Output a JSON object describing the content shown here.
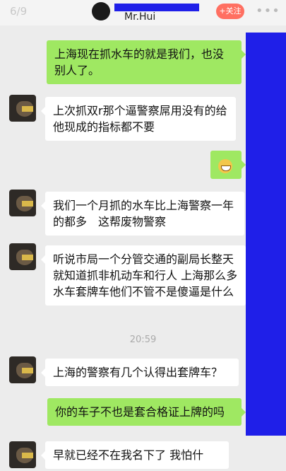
{
  "header": {
    "counter": "6/9",
    "username": "Mr.Hui",
    "follow_label": "+关注",
    "more_icon": "more-dots-icon"
  },
  "timestamp": "20:59",
  "messages": [
    {
      "side": "right",
      "text": "上海现在抓水车的就是我们，也没别人了。"
    },
    {
      "side": "left",
      "text": "上次抓双r那个逼警察屌用没有的给他现成的指标都不要"
    },
    {
      "side": "right",
      "text": "",
      "emoji": "grinning-face-icon"
    },
    {
      "side": "left",
      "text": "我们一个月抓的水车比上海警察一年的都多　这帮废物警察"
    },
    {
      "side": "left",
      "text": "听说市局一个分管交通的副局长整天就知道抓非机动车和行人 上海那么多水车套牌车他们不管不是傻逼是什么"
    },
    {
      "side": "left",
      "text": "上海的警察有几个认得出套牌车？"
    },
    {
      "side": "right",
      "text": "你的车子不也是套合格证上牌的吗"
    },
    {
      "side": "left",
      "text": "早就已经不在我名下了 我怕什"
    }
  ],
  "colors": {
    "redaction": "#1f1fe8",
    "sent_bubble": "#9fe862",
    "follow_button": "#ff6f61"
  }
}
